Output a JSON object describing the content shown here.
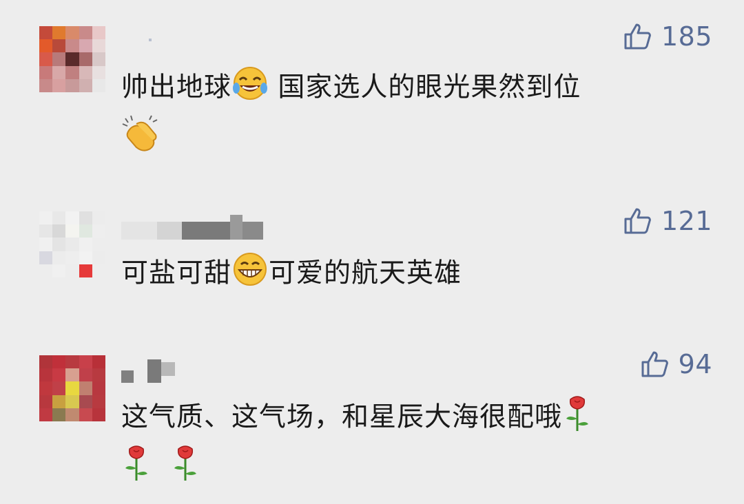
{
  "comments": [
    {
      "likes": "185",
      "text_a": "帅出地球",
      "text_b": " 国家选人的眼光果然到位",
      "emojis": [
        "laughing-tears-emoji",
        "clapping-hands-emoji"
      ],
      "avatar_colors": [
        "#c44a3a",
        "#e07a2e",
        "#d98a6a",
        "#c98a8a",
        "#e8c8c8",
        "#e35a2a",
        "#b84a3a",
        "#c98a8a",
        "#d8a8b0",
        "#e8d8d8",
        "#d85a4a",
        "#b87a7a",
        "#5a2a2a",
        "#a86a6a",
        "#d8c8c8",
        "#c87a7a",
        "#d8a8a8",
        "#c08080",
        "#d8b8b8",
        "#e8e0e0",
        "#c88a8a",
        "#d8a0a0",
        "#c89a9a",
        "#d0b0b0",
        "#e8e8e8"
      ]
    },
    {
      "likes": "121",
      "text_a": "可盐可甜",
      "text_b": "可爱的航天英雄",
      "emojis": [
        "grinning-emoji"
      ],
      "avatar_colors": [
        "#f0f0f0",
        "#e8e8e8",
        "#f2f2f2",
        "#e0e0e0",
        "#ececec",
        "#e6e6e6",
        "#d8d8d8",
        "#f4f4f0",
        "#e0e8e0",
        "#eeeeee",
        "#f0f0f0",
        "#e4e4e4",
        "#eaeaea",
        "#f0f0f0",
        "#ededed",
        "#d8d8e0",
        "#ececec",
        "#eeeeee",
        "#f2f2f2",
        "#ececec",
        "#ededed",
        "#f0f0f0",
        "#ededed",
        "#e63a3a",
        "#ededed"
      ]
    },
    {
      "likes": "94",
      "text_a": "这气质、这气场，和星辰大海很配哦",
      "text_b": "",
      "emojis": [
        "rose-emoji",
        "rose-emoji",
        "rose-emoji"
      ],
      "avatar_colors": [
        "#b0343a",
        "#c0303a",
        "#b83a40",
        "#c8404a",
        "#b83038",
        "#b8343c",
        "#c83a44",
        "#d8a090",
        "#c0404a",
        "#b83a40",
        "#c0383e",
        "#c04048",
        "#e8d840",
        "#c08070",
        "#b83840",
        "#b8383e",
        "#c8a040",
        "#d8c850",
        "#a84a50",
        "#b83a40",
        "#c03a42",
        "#8a7a50",
        "#c08a70",
        "#c84a50",
        "#b8343c"
      ]
    }
  ],
  "colors": {
    "background": "#ededed",
    "like_blue": "#576b95",
    "text": "#1a1a1a"
  }
}
